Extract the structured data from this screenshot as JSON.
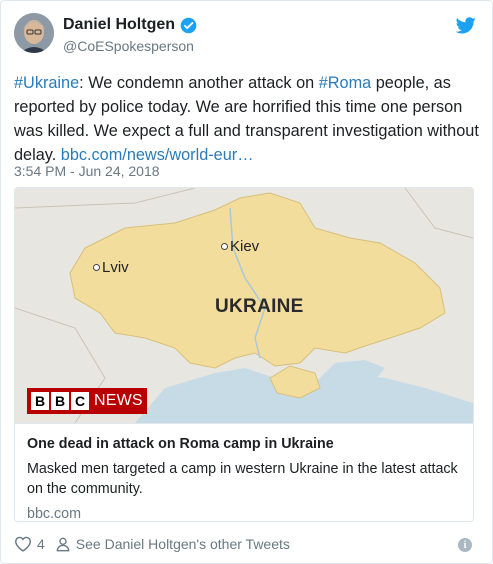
{
  "author": {
    "display_name": "Daniel Holtgen",
    "handle": "@CoESpokesperson",
    "verified": true
  },
  "tweet": {
    "hashtag_1": "#Ukraine",
    "text_1": ": We condemn another attack on ",
    "hashtag_2": "#Roma",
    "text_2": " people, as reported by police today. We are horrified this time one person was killed. We expect a full and transparent investigation without delay. ",
    "link": "bbc.com/news/world-eur…",
    "timestamp": "3:54 PM - Jun 24, 2018"
  },
  "card": {
    "map": {
      "city_1": "Kiev",
      "city_2": "Lviv",
      "country": "UKRAINE"
    },
    "logo": {
      "box_1": "B",
      "box_2": "B",
      "box_3": "C",
      "news": "NEWS"
    },
    "title": "One dead in attack on Roma camp in Ukraine",
    "description": "Masked men targeted a camp in western Ukraine in the latest attack on the community.",
    "domain": "bbc.com"
  },
  "actions": {
    "like_count": "4",
    "other_tweets": "See Daniel Holtgen's other Tweets"
  },
  "icons": {
    "verified": "verified-badge-icon",
    "brand": "twitter-bird-icon",
    "like": "heart-icon",
    "profile": "person-icon",
    "info": "info-icon"
  },
  "colors": {
    "link": "#2b7bb9",
    "secondary_text": "#697882",
    "verified": "#1da1f2",
    "bbc_red": "#b80000",
    "map_land": "#f3dd9c",
    "map_water": "#c6dbe6"
  }
}
